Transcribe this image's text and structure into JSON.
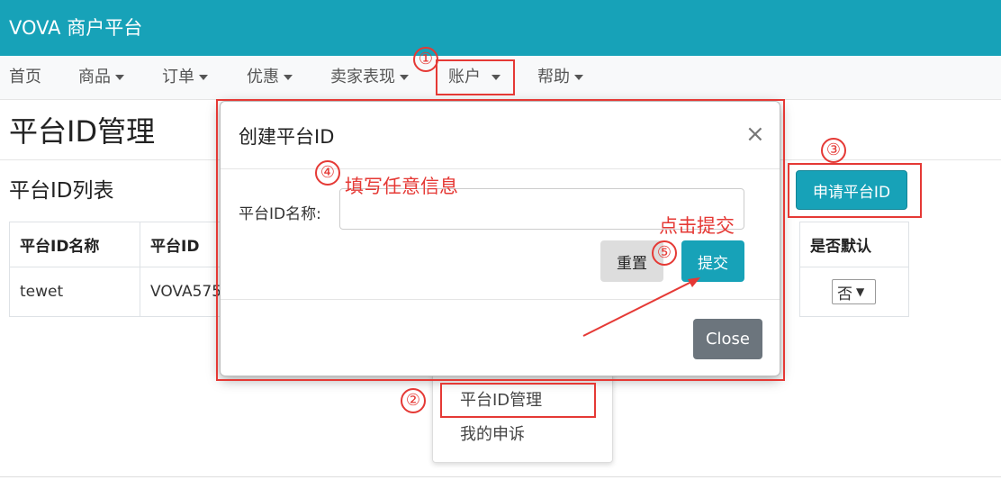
{
  "app": {
    "brand": "VOVA 商户平台"
  },
  "nav": {
    "home": "首页",
    "products": "商品",
    "orders": "订单",
    "promotions": "优惠",
    "seller_performance": "卖家表现",
    "account": "账户",
    "help": "帮助"
  },
  "page": {
    "title": "平台ID管理",
    "list_title": "平台ID列表",
    "apply_button": "申请平台ID"
  },
  "table": {
    "headers": [
      "平台ID名称",
      "平台ID",
      "是否默认"
    ],
    "rows": [
      {
        "name": "tewet",
        "id": "VOVA575",
        "default": "否"
      }
    ]
  },
  "dropdown_menu": {
    "items": [
      "平台ID管理",
      "我的申诉"
    ]
  },
  "modal": {
    "title": "创建平台ID",
    "close_symbol": "×",
    "field_label": "平台ID名称:",
    "field_value": "",
    "reset_button": "重置",
    "submit_button": "提交",
    "close_button": "Close"
  },
  "annotations": {
    "step1": "①",
    "step2": "②",
    "step3": "③",
    "step4": "④",
    "step5": "⑤",
    "fill_hint": "填写任意信息",
    "click_hint": "点击提交"
  },
  "colors": {
    "primary": "#17a2b8",
    "annotation": "#e53935",
    "secondary_button": "#6c757d"
  }
}
